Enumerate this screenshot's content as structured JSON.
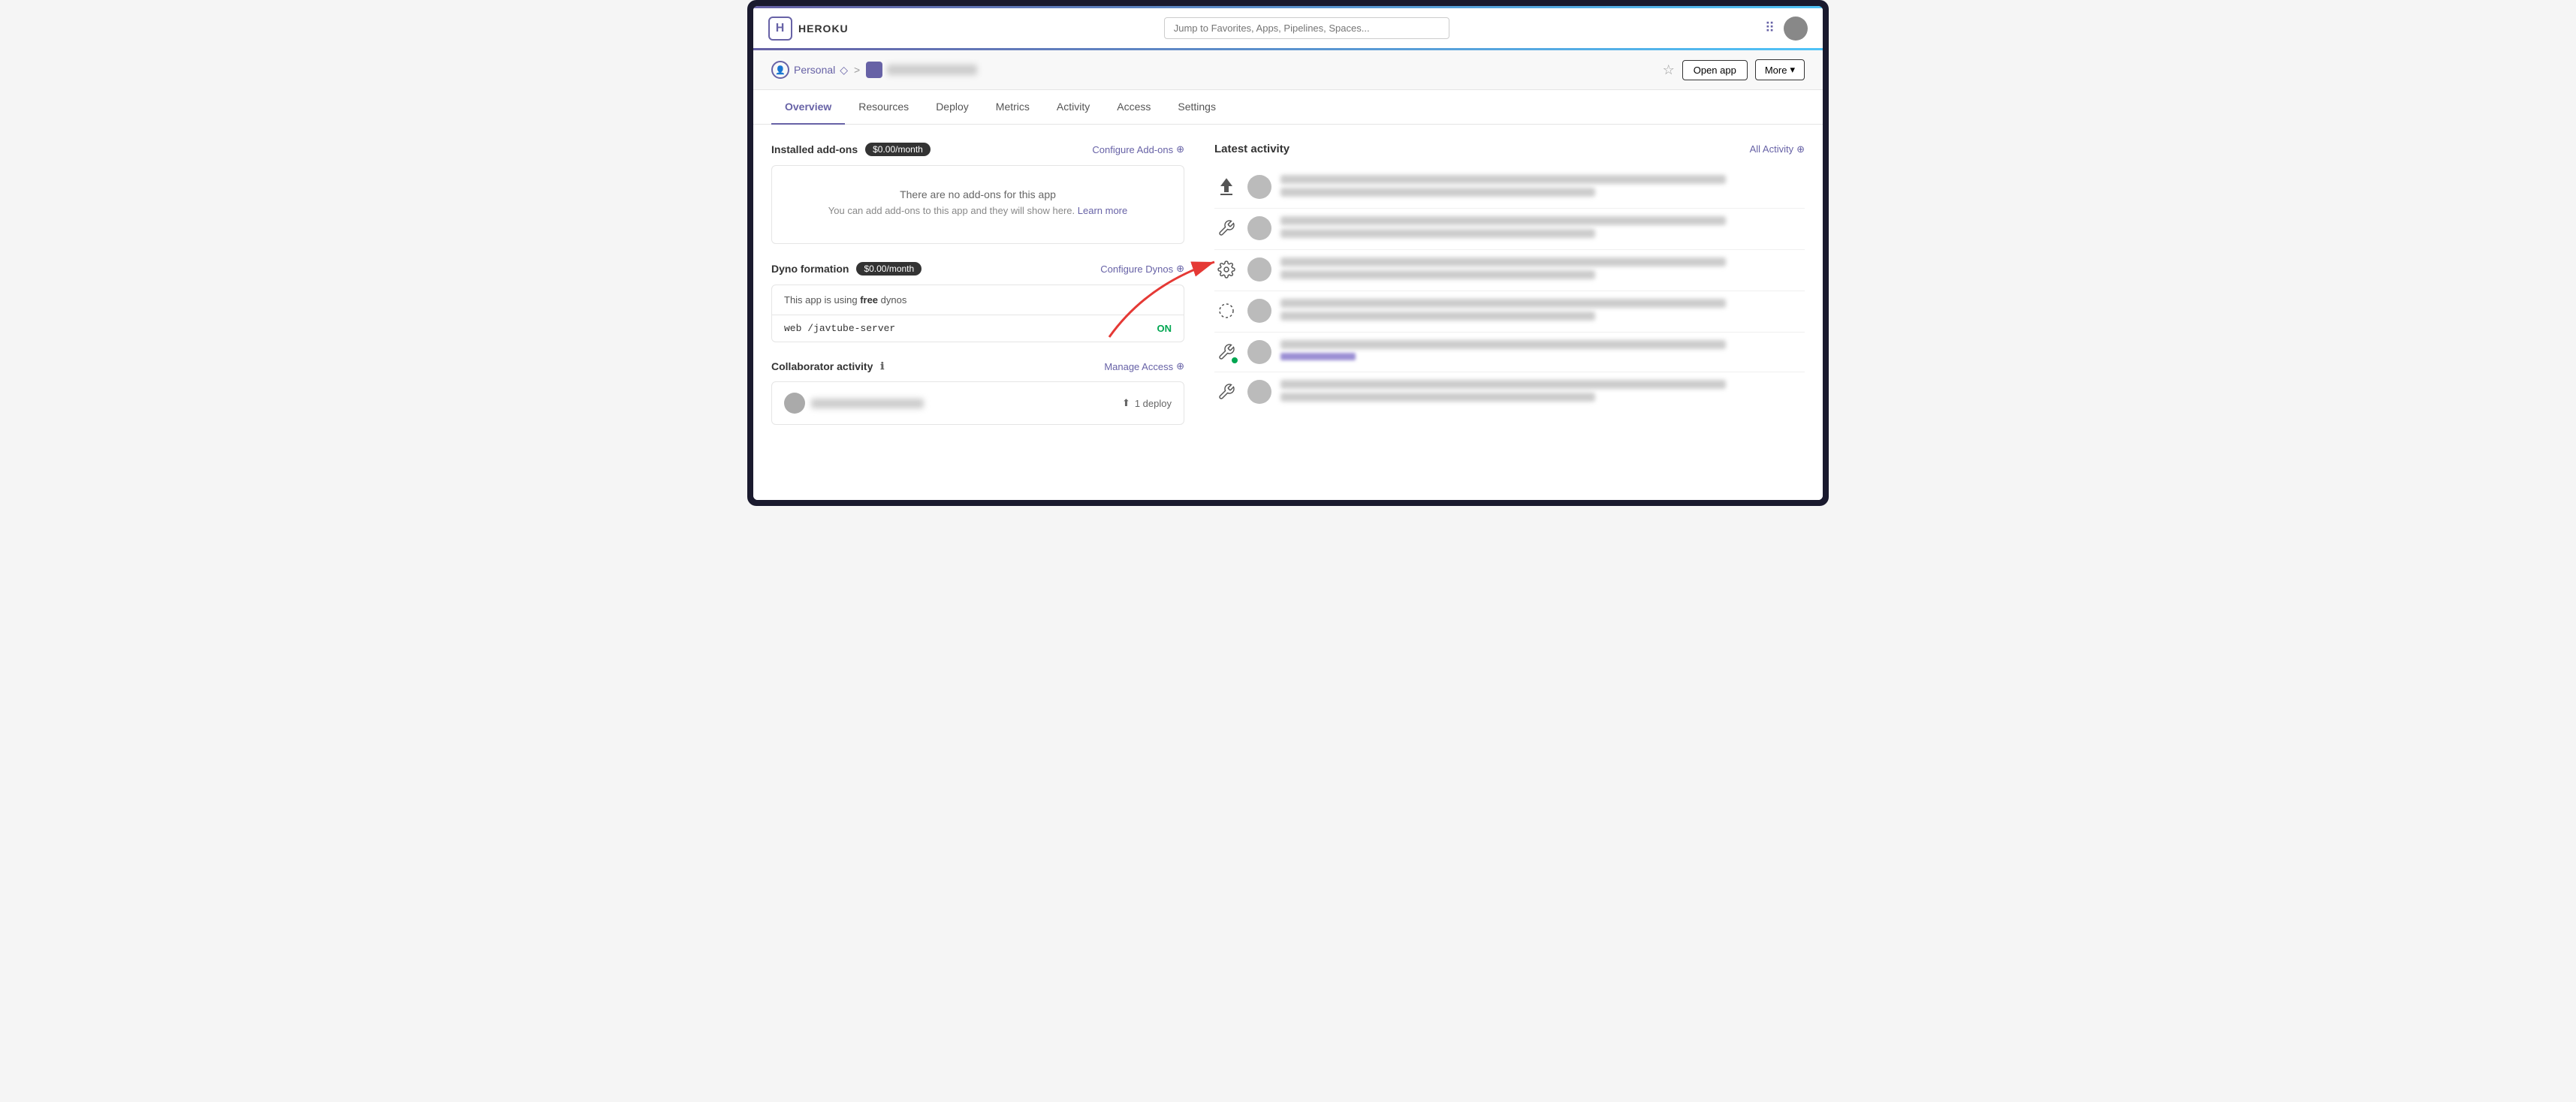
{
  "brand": {
    "logo_letter": "H",
    "name": "HEROKU"
  },
  "search": {
    "placeholder": "Jump to Favorites, Apps, Pipelines, Spaces..."
  },
  "breadcrumb": {
    "account_label": "Personal",
    "separator": ">",
    "app_name": "app-name-blurred"
  },
  "actions": {
    "star_label": "☆",
    "open_app_label": "Open app",
    "more_label": "More",
    "more_chevron": "▾"
  },
  "tabs": [
    {
      "id": "overview",
      "label": "Overview",
      "active": true
    },
    {
      "id": "resources",
      "label": "Resources",
      "active": false
    },
    {
      "id": "deploy",
      "label": "Deploy",
      "active": false
    },
    {
      "id": "metrics",
      "label": "Metrics",
      "active": false
    },
    {
      "id": "activity",
      "label": "Activity",
      "active": false
    },
    {
      "id": "access",
      "label": "Access",
      "active": false
    },
    {
      "id": "settings",
      "label": "Settings",
      "active": false
    }
  ],
  "addons": {
    "title": "Installed add-ons",
    "badge": "$0.00/month",
    "configure_link": "Configure Add-ons",
    "empty_title": "There are no add-ons for this app",
    "empty_sub": "You can add add-ons to this app and they will show here.",
    "learn_more": "Learn more"
  },
  "dynos": {
    "title": "Dyno formation",
    "badge": "$0.00/month",
    "configure_link": "Configure Dynos",
    "info_text": "This app is using",
    "info_bold": "free",
    "info_suffix": "dynos",
    "web_label": "web",
    "web_command": "/javtube-server",
    "status": "ON"
  },
  "collaborator": {
    "title": "Collaborator activity",
    "info_icon": "ℹ",
    "manage_link": "Manage Access",
    "deploy_count": "1 deploy",
    "deploy_icon": "⬆"
  },
  "activity": {
    "title": "Latest activity",
    "all_activity_link": "All Activity",
    "items": [
      {
        "icon_type": "upload",
        "has_link": false
      },
      {
        "icon_type": "wrench",
        "has_link": false
      },
      {
        "icon_type": "gear",
        "has_link": false
      },
      {
        "icon_type": "circle-dashed",
        "has_link": false
      },
      {
        "icon_type": "build",
        "has_link": true
      },
      {
        "icon_type": "wrench2",
        "has_link": false
      }
    ]
  }
}
